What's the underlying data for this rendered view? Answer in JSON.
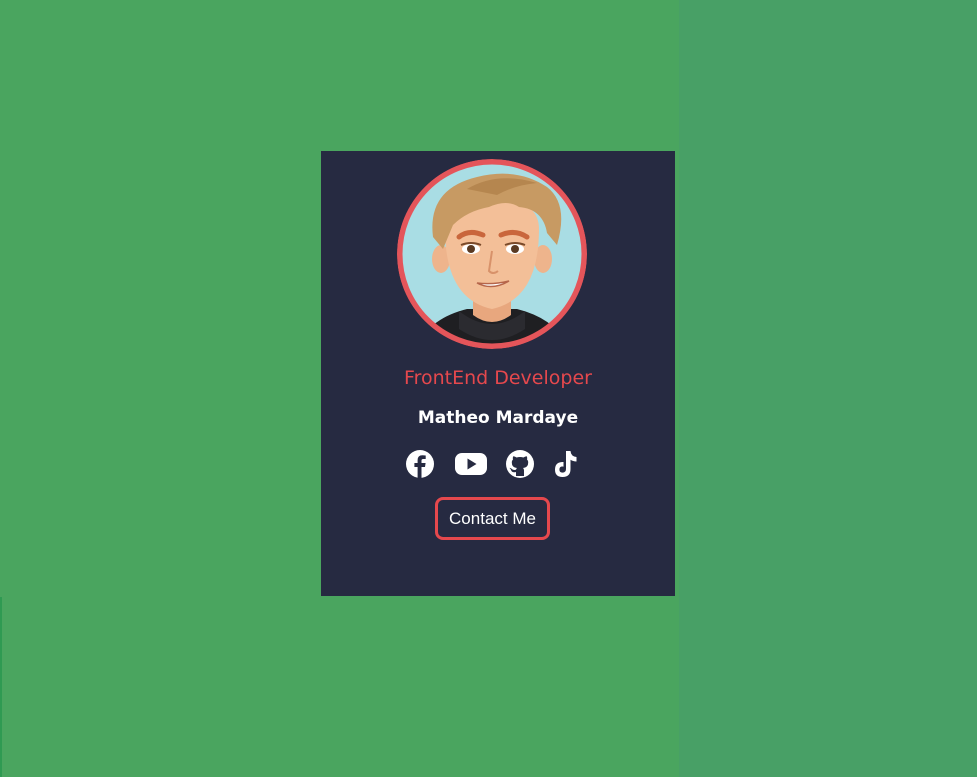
{
  "profile": {
    "role": "FrontEnd Developer",
    "name": "Matheo Mardaye",
    "contact_label": "Contact Me"
  },
  "social_icons": [
    "facebook-icon",
    "youtube-icon",
    "github-icon",
    "tiktok-icon"
  ],
  "colors": {
    "page_background": "#4aa55f",
    "card_background": "#262a41",
    "accent": "#e5484d",
    "text": "#ffffff"
  }
}
